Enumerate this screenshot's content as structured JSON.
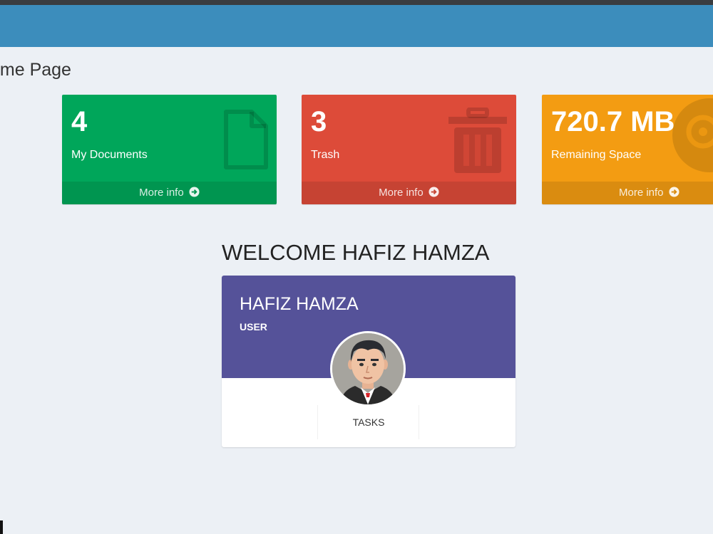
{
  "header": {
    "page_title": "ome Page"
  },
  "boxes": [
    {
      "value": "4",
      "label": "My Documents",
      "footer": "More info",
      "color": "#00a65a",
      "icon": "file-icon"
    },
    {
      "value": "3",
      "label": "Trash",
      "footer": "More info",
      "color": "#dd4b39",
      "icon": "trash-icon"
    },
    {
      "value": "720.7 MB",
      "label": "Remaining Space",
      "footer": "More info",
      "color": "#f39c12",
      "icon": "disc-icon"
    }
  ],
  "welcome": {
    "heading": "WELCOME HAFIZ HAMZA"
  },
  "profile": {
    "name": "HAFIZ HAMZA",
    "role": "USER",
    "tasks_label": "TASKS",
    "header_color": "#555299"
  },
  "colors": {
    "navbar": "#3c8dbc",
    "background": "#ecf0f5"
  }
}
